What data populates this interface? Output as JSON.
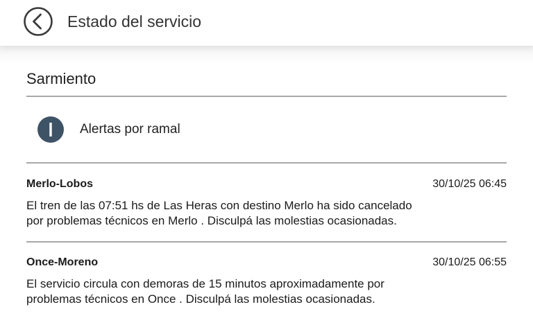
{
  "header": {
    "title": "Estado del servicio",
    "back_icon": "back-arrow-circle-icon"
  },
  "line": {
    "name": "Sarmiento"
  },
  "info_row": {
    "icon": "info-icon",
    "icon_color": "#3f5366",
    "label": "Alertas por ramal"
  },
  "alerts": [
    {
      "branch": "Merlo-Lobos",
      "timestamp": "30/10/25 06:45",
      "message_line1": "El tren de las 07:51 hs de Las Heras con destino Merlo ha sido cancelado",
      "message_line2": "por problemas técnicos en Merlo . Disculpá las molestias ocasionadas."
    },
    {
      "branch": "Once-Moreno",
      "timestamp": "30/10/25 06:55",
      "message_line1": "El servicio circula con demoras de 15 minutos aproximadamente por",
      "message_line2": "problemas técnicos en Once . Disculpá las molestias ocasionadas."
    }
  ]
}
